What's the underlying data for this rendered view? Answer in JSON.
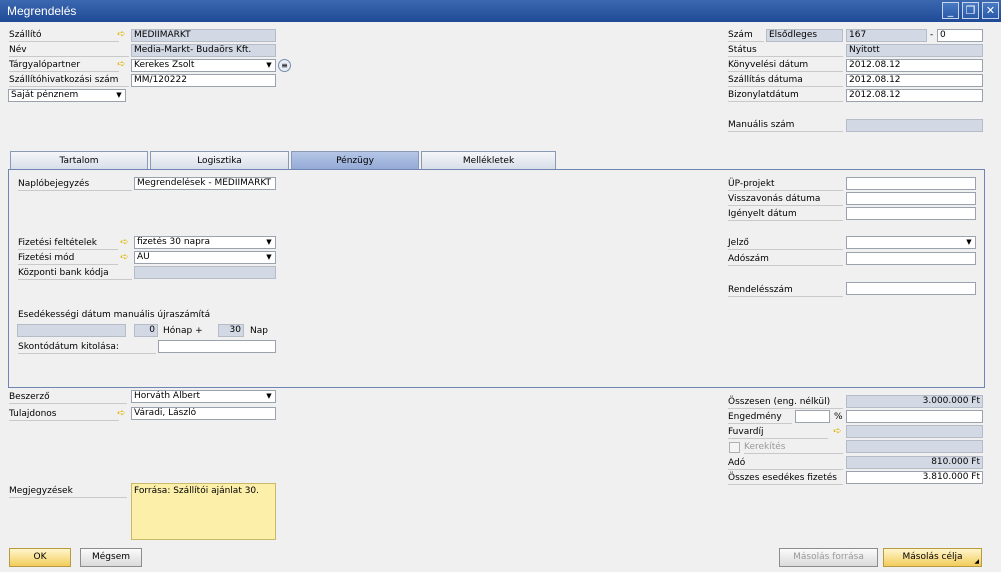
{
  "window": {
    "title": "Megrendelés"
  },
  "header": {
    "supplier_label": "Szállító",
    "supplier_value": "MEDIIMARKT",
    "name_label": "Név",
    "name_value": "Media-Markt- Budaörs Kft.",
    "contact_label": "Tárgyalópartner",
    "contact_value": "Kerekes Zsolt",
    "ref_label": "Szállítóhivatkozási szám",
    "ref_value": "MM/120222",
    "currency_value": "Saját pénznem",
    "number_label": "Szám",
    "series_value": "Elsődleges",
    "number_value": "167",
    "number_sep": "-",
    "number_suffix": "0",
    "status_label": "Státus",
    "status_value": "Nyitott",
    "posting_date_label": "Könyvelési dátum",
    "posting_date_value": "2012.08.12",
    "delivery_date_label": "Szállítás dátuma",
    "delivery_date_value": "2012.08.12",
    "document_date_label": "Bizonylatdátum",
    "document_date_value": "2012.08.12",
    "manual_number_label": "Manuális szám",
    "manual_number_value": ""
  },
  "tabs": [
    {
      "label": "Tartalom",
      "active": false
    },
    {
      "label": "Logisztika",
      "active": false
    },
    {
      "label": "Pénzügy",
      "active": true
    },
    {
      "label": "Mellékletek",
      "active": false
    }
  ],
  "finance": {
    "journal_label": "Naplóbejegyzés",
    "journal_value": "Megrendelések - MEDIIMARKT",
    "payment_terms_label": "Fizetési feltételek",
    "payment_terms_value": "fizetés 30 napra",
    "payment_method_label": "Fizetési mód",
    "payment_method_value": "AU",
    "bank_code_label": "Központi bank kódja",
    "bank_code_value": "",
    "due_recalc_label": "Esedékességi dátum manuális újraszámítá",
    "due_recalc_date": "",
    "months_value": "0",
    "months_label": "Hónap +",
    "days_value": "30",
    "days_label": "Nap",
    "discount_date_label": "Skontódátum kitolása:",
    "discount_date_value": "",
    "project_label": "ÜP-projekt",
    "project_value": "",
    "cancel_date_label": "Visszavonás dátuma",
    "cancel_date_value": "",
    "requested_date_label": "Igényelt dátum",
    "requested_date_value": "",
    "indicator_label": "Jelző",
    "indicator_value": "",
    "tax_number_label": "Adószám",
    "tax_number_value": "",
    "order_number_label": "Rendelésszám",
    "order_number_value": ""
  },
  "footer": {
    "buyer_label": "Beszerző",
    "buyer_value": "Horváth Albert",
    "owner_label": "Tulajdonos",
    "owner_value": "Váradi, László",
    "remarks_label": "Megjegyzések",
    "remarks_value": "Forrása: Szállítói ajánlat 30.",
    "total_before_label": "Összesen (eng. nélkül)",
    "total_before_value": "3.000.000 Ft",
    "discount_label": "Engedmény",
    "discount_pct_value": "",
    "discount_pct_sign": "%",
    "discount_amount_value": "",
    "freight_label": "Fuvardíj",
    "freight_value": "",
    "rounding_label": "Kerekítés",
    "rounding_value": "",
    "tax_label": "Adó",
    "tax_value": "810.000 Ft",
    "total_due_label": "Összes esedékes fizetés",
    "total_due_value": "3.810.000 Ft"
  },
  "buttons": {
    "ok": "OK",
    "cancel": "Mégsem",
    "copy_from": "Másolás forrása",
    "copy_to": "Másolás célja"
  },
  "icons": {
    "link_arrow": "yellow-link-arrow-icon",
    "dropdown": "dropdown-arrow-icon",
    "contact_list": "list-button-icon",
    "minimize": "minimize-icon",
    "restore": "restore-icon",
    "close": "close-icon"
  },
  "colors": {
    "titlebar": "#2a5aa6",
    "readonly_field": "#d3d9e4",
    "note_field": "#fbefa9",
    "primary_button": "#f2cc5b"
  }
}
